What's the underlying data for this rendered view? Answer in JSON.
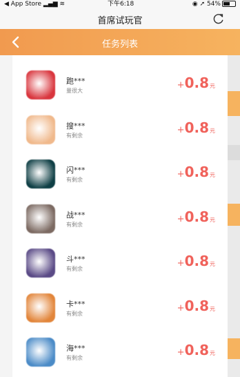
{
  "status_bar": {
    "back_app": "App Store",
    "time": "下午6:18",
    "battery": "54%"
  },
  "header": {
    "title": "首席试玩官",
    "refresh_icon": "refresh-icon"
  },
  "nav": {
    "title": "任务列表",
    "back_icon": "chevron-left-icon"
  },
  "tasks": [
    {
      "name": "跑***",
      "status": "量很大",
      "plus": "+",
      "amount": "0.8",
      "unit": "元",
      "icon_color": "#d9363e"
    },
    {
      "name": "搜***",
      "status": "有剩余",
      "plus": "+",
      "amount": "0.8",
      "unit": "元",
      "icon_color": "#f0b98c"
    },
    {
      "name": "闪***",
      "status": "有剩余",
      "plus": "+",
      "amount": "0.8",
      "unit": "元",
      "icon_color": "#0f3f45"
    },
    {
      "name": "战***",
      "status": "有剩余",
      "plus": "+",
      "amount": "0.8",
      "unit": "元",
      "icon_color": "#7c6a62"
    },
    {
      "name": "斗***",
      "status": "有剩余",
      "plus": "+",
      "amount": "0.8",
      "unit": "元",
      "icon_color": "#5a4a86"
    },
    {
      "name": "卡***",
      "status": "有剩余",
      "plus": "+",
      "amount": "0.8",
      "unit": "元",
      "icon_color": "#e2853a"
    },
    {
      "name": "海***",
      "status": "有剩余",
      "plus": "+",
      "amount": "0.8",
      "unit": "元",
      "icon_color": "#4b8bc7"
    }
  ],
  "colors": {
    "accent_orange": "#f19a4f",
    "reward_red": "#f0625b"
  }
}
